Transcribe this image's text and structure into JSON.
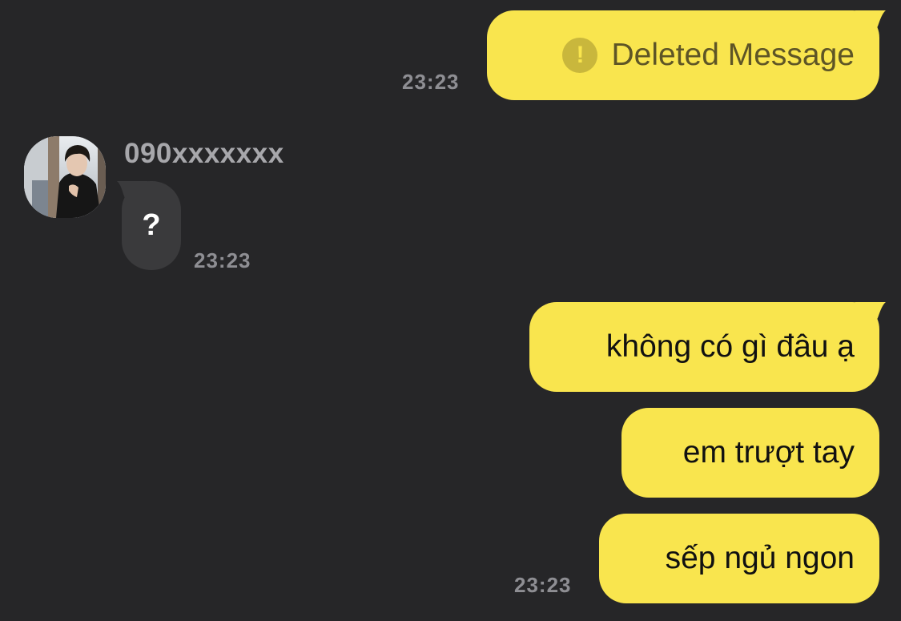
{
  "colors": {
    "background": "#262628",
    "outgoing_bubble": "#f9e54e",
    "incoming_bubble": "#3a3a3c",
    "timestamp": "#8e8e93",
    "deleted_text": "#5e5526"
  },
  "messages": [
    {
      "direction": "outgoing",
      "text": "Deleted Message",
      "icon": "exclamation-circle-icon",
      "deleted": true,
      "time": "23:23"
    },
    {
      "direction": "incoming",
      "sender": "090xxxxxxx",
      "avatar_icon": "profile-photo",
      "text": "?",
      "time": "23:23"
    },
    {
      "direction": "outgoing",
      "text": "không có gì đâu ạ"
    },
    {
      "direction": "outgoing",
      "text": "em trượt tay"
    },
    {
      "direction": "outgoing",
      "text": "sếp ngủ ngon",
      "time": "23:23"
    }
  ]
}
